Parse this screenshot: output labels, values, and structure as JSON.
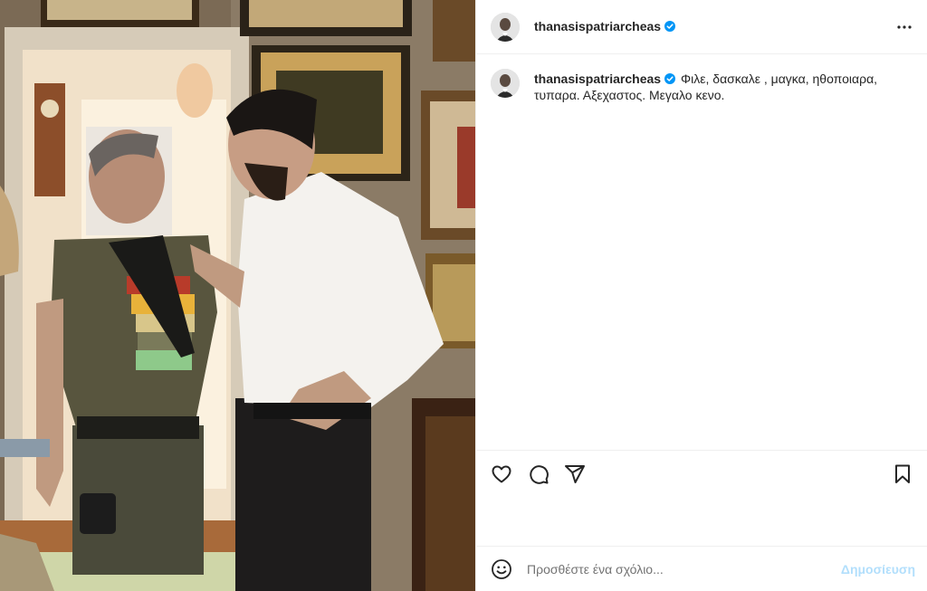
{
  "post": {
    "username": "thanasispatriarcheas",
    "verified": true,
    "caption": "Φιλε, δασκαλε , μαγκα, ηθοποιαρα, τυπαρα. Αξεχαστος. Μεγαλο κενο."
  },
  "comment": {
    "placeholder": "Προσθέστε ένα σχόλιο...",
    "post_label": "Δημοσίευση"
  },
  "icons": {
    "more": "more-options-icon",
    "like": "heart-icon",
    "comment": "comment-icon",
    "share": "share-icon",
    "save": "bookmark-icon",
    "emoji": "emoji-icon",
    "verified": "verified-badge-icon"
  },
  "colors": {
    "verified": "#0095f6",
    "post_button_disabled": "#b2dffc",
    "placeholder": "#737373",
    "border": "#efefef"
  }
}
